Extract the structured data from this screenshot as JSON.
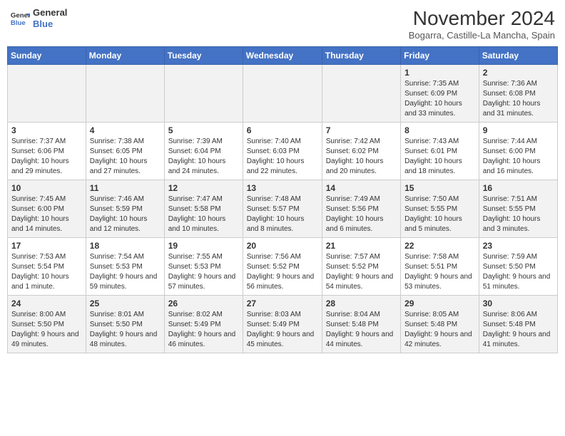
{
  "header": {
    "logo_line1": "General",
    "logo_line2": "Blue",
    "month_title": "November 2024",
    "subtitle": "Bogarra, Castille-La Mancha, Spain"
  },
  "weekdays": [
    "Sunday",
    "Monday",
    "Tuesday",
    "Wednesday",
    "Thursday",
    "Friday",
    "Saturday"
  ],
  "weeks": [
    [
      {
        "day": "",
        "info": ""
      },
      {
        "day": "",
        "info": ""
      },
      {
        "day": "",
        "info": ""
      },
      {
        "day": "",
        "info": ""
      },
      {
        "day": "",
        "info": ""
      },
      {
        "day": "1",
        "info": "Sunrise: 7:35 AM\nSunset: 6:09 PM\nDaylight: 10 hours and 33 minutes."
      },
      {
        "day": "2",
        "info": "Sunrise: 7:36 AM\nSunset: 6:08 PM\nDaylight: 10 hours and 31 minutes."
      }
    ],
    [
      {
        "day": "3",
        "info": "Sunrise: 7:37 AM\nSunset: 6:06 PM\nDaylight: 10 hours and 29 minutes."
      },
      {
        "day": "4",
        "info": "Sunrise: 7:38 AM\nSunset: 6:05 PM\nDaylight: 10 hours and 27 minutes."
      },
      {
        "day": "5",
        "info": "Sunrise: 7:39 AM\nSunset: 6:04 PM\nDaylight: 10 hours and 24 minutes."
      },
      {
        "day": "6",
        "info": "Sunrise: 7:40 AM\nSunset: 6:03 PM\nDaylight: 10 hours and 22 minutes."
      },
      {
        "day": "7",
        "info": "Sunrise: 7:42 AM\nSunset: 6:02 PM\nDaylight: 10 hours and 20 minutes."
      },
      {
        "day": "8",
        "info": "Sunrise: 7:43 AM\nSunset: 6:01 PM\nDaylight: 10 hours and 18 minutes."
      },
      {
        "day": "9",
        "info": "Sunrise: 7:44 AM\nSunset: 6:00 PM\nDaylight: 10 hours and 16 minutes."
      }
    ],
    [
      {
        "day": "10",
        "info": "Sunrise: 7:45 AM\nSunset: 6:00 PM\nDaylight: 10 hours and 14 minutes."
      },
      {
        "day": "11",
        "info": "Sunrise: 7:46 AM\nSunset: 5:59 PM\nDaylight: 10 hours and 12 minutes."
      },
      {
        "day": "12",
        "info": "Sunrise: 7:47 AM\nSunset: 5:58 PM\nDaylight: 10 hours and 10 minutes."
      },
      {
        "day": "13",
        "info": "Sunrise: 7:48 AM\nSunset: 5:57 PM\nDaylight: 10 hours and 8 minutes."
      },
      {
        "day": "14",
        "info": "Sunrise: 7:49 AM\nSunset: 5:56 PM\nDaylight: 10 hours and 6 minutes."
      },
      {
        "day": "15",
        "info": "Sunrise: 7:50 AM\nSunset: 5:55 PM\nDaylight: 10 hours and 5 minutes."
      },
      {
        "day": "16",
        "info": "Sunrise: 7:51 AM\nSunset: 5:55 PM\nDaylight: 10 hours and 3 minutes."
      }
    ],
    [
      {
        "day": "17",
        "info": "Sunrise: 7:53 AM\nSunset: 5:54 PM\nDaylight: 10 hours and 1 minute."
      },
      {
        "day": "18",
        "info": "Sunrise: 7:54 AM\nSunset: 5:53 PM\nDaylight: 9 hours and 59 minutes."
      },
      {
        "day": "19",
        "info": "Sunrise: 7:55 AM\nSunset: 5:53 PM\nDaylight: 9 hours and 57 minutes."
      },
      {
        "day": "20",
        "info": "Sunrise: 7:56 AM\nSunset: 5:52 PM\nDaylight: 9 hours and 56 minutes."
      },
      {
        "day": "21",
        "info": "Sunrise: 7:57 AM\nSunset: 5:52 PM\nDaylight: 9 hours and 54 minutes."
      },
      {
        "day": "22",
        "info": "Sunrise: 7:58 AM\nSunset: 5:51 PM\nDaylight: 9 hours and 53 minutes."
      },
      {
        "day": "23",
        "info": "Sunrise: 7:59 AM\nSunset: 5:50 PM\nDaylight: 9 hours and 51 minutes."
      }
    ],
    [
      {
        "day": "24",
        "info": "Sunrise: 8:00 AM\nSunset: 5:50 PM\nDaylight: 9 hours and 49 minutes."
      },
      {
        "day": "25",
        "info": "Sunrise: 8:01 AM\nSunset: 5:50 PM\nDaylight: 9 hours and 48 minutes."
      },
      {
        "day": "26",
        "info": "Sunrise: 8:02 AM\nSunset: 5:49 PM\nDaylight: 9 hours and 46 minutes."
      },
      {
        "day": "27",
        "info": "Sunrise: 8:03 AM\nSunset: 5:49 PM\nDaylight: 9 hours and 45 minutes."
      },
      {
        "day": "28",
        "info": "Sunrise: 8:04 AM\nSunset: 5:48 PM\nDaylight: 9 hours and 44 minutes."
      },
      {
        "day": "29",
        "info": "Sunrise: 8:05 AM\nSunset: 5:48 PM\nDaylight: 9 hours and 42 minutes."
      },
      {
        "day": "30",
        "info": "Sunrise: 8:06 AM\nSunset: 5:48 PM\nDaylight: 9 hours and 41 minutes."
      }
    ]
  ]
}
